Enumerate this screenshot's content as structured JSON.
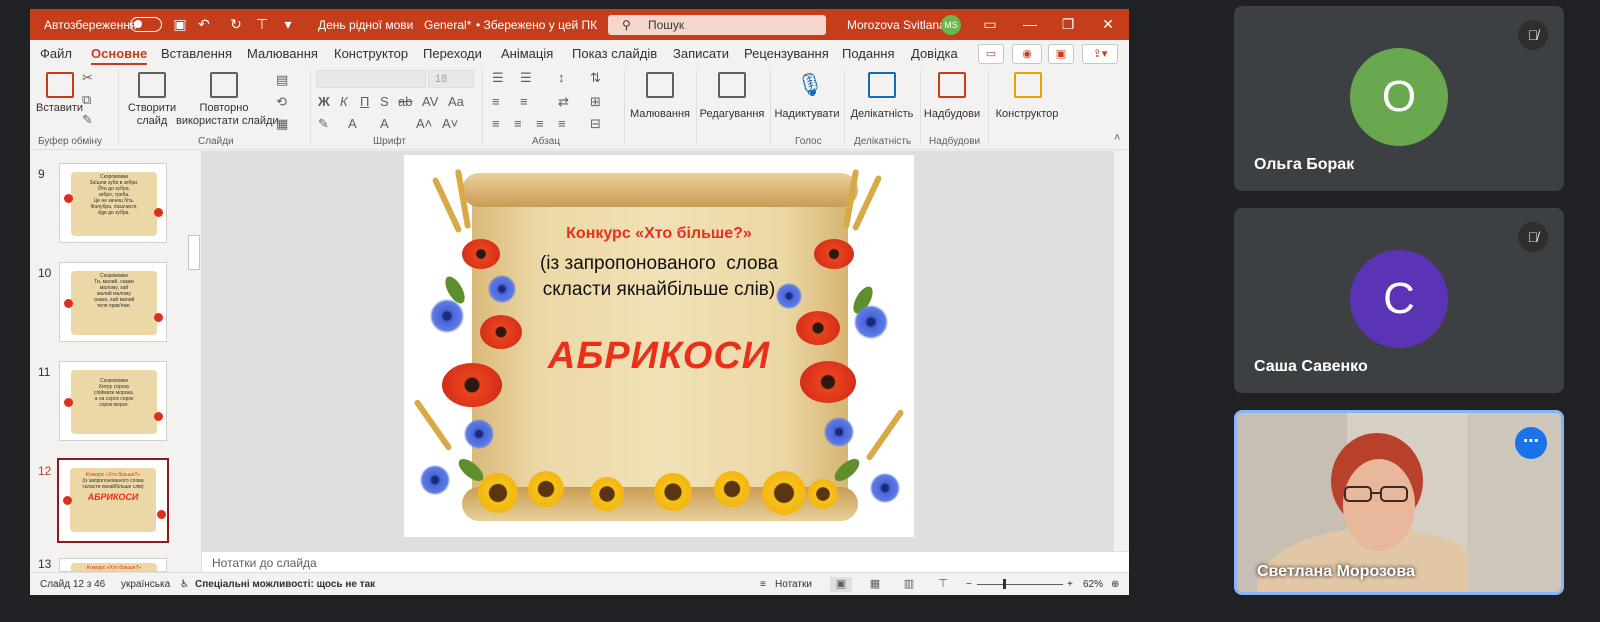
{
  "titlebar": {
    "autosave_label": "Автозбереження",
    "doc_title": "День рідної мови",
    "sensitivity": "General*",
    "save_state": "• Збережено у цей ПК",
    "search_placeholder": "Пошук",
    "user_name": "Morozova Svitlana",
    "user_initials": "MS"
  },
  "tabs": [
    "Файл",
    "Основне",
    "Вставлення",
    "Малювання",
    "Конструктор",
    "Переходи",
    "Анімація",
    "Показ слайдів",
    "Записати",
    "Рецензування",
    "Подання",
    "Довідка"
  ],
  "active_tab": "Основне",
  "ribbon": {
    "paste": "Вставити",
    "group_clipboard": "Буфер обміну",
    "new_slide_1": "Створити",
    "new_slide_2": "слайд",
    "reuse_1": "Повторно",
    "reuse_2": "використати слайди",
    "group_slides": "Слайди",
    "font_size": "18",
    "group_font": "Шрифт",
    "group_paragraph": "Абзац",
    "drawing": "Малювання",
    "editing": "Редагування",
    "dictate": "Надиктувати",
    "group_voice": "Голос",
    "sensitivity": "Делікатність",
    "group_sensitivity": "Делікатність",
    "addins": "Надбудови",
    "group_addins": "Надбудови",
    "designer": "Конструктор"
  },
  "thumbnails": [
    {
      "num": "9",
      "lines": [
        "Скоромовки",
        "Заїшли зуби в зебри.",
        "Йти до зубра,",
        "зебро, треба.",
        "Це не зачеш біть.",
        "Фалубра, пієшчислі,",
        "йди до зубра."
      ],
      "selected": false
    },
    {
      "num": "10",
      "lines": [
        "Скоромовки",
        "Ти, малий, скажи",
        "малому, хай",
        "малий малому",
        "скаже, хай малий",
        "теля прив'яже."
      ],
      "selected": false
    },
    {
      "num": "11",
      "lines": [
        "Скоромовки",
        "Хитру сороку",
        "спіймати морока,",
        "а на сорок сорок",
        "сорок морок."
      ],
      "selected": false
    },
    {
      "num": "12",
      "lines": [
        "Конкурс «Хто більше?»",
        "(із запропонованого слова",
        "скласти якнайбільше слів)",
        "АБРИКОСИ"
      ],
      "selected": true
    },
    {
      "num": "13",
      "lines": [
        "Конкурс «Хто більше?»"
      ],
      "selected": false
    }
  ],
  "slide": {
    "title": "Конкурс «Хто більше?»",
    "subtitle_1": "(із запропонованого  слова",
    "subtitle_2": "скласти якнайбільше слів)",
    "word": "АБРИКОСИ"
  },
  "notes_placeholder": "Нотатки до слайда",
  "status": {
    "slide_of": "Слайд 12 з 46",
    "language": "українська",
    "accessibility": "Спеціальні можливості: щось не так",
    "notes_btn": "Нотатки",
    "zoom": "62%"
  },
  "participants": [
    {
      "name": "Ольга Борак",
      "initial": "О",
      "color": "#6aa84f",
      "muted": true
    },
    {
      "name": "Саша Савенко",
      "initial": "С",
      "color": "#5b33b5",
      "muted": true
    },
    {
      "name": "Светлана Морозова",
      "initial": "",
      "video": true
    }
  ]
}
